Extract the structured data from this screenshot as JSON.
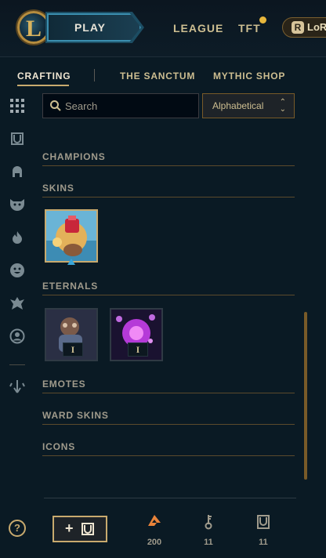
{
  "header": {
    "play_label": "PLAY",
    "nav": [
      "LEAGUE",
      "TFT"
    ],
    "lor_label": "LoR",
    "lor_icon": "R"
  },
  "tabs": [
    {
      "label": "CRAFTING",
      "active": true
    },
    {
      "label": "THE SANCTUM",
      "active": false
    },
    {
      "label": "MYTHIC SHOP",
      "active": false
    }
  ],
  "rail_icons": [
    "grid-icon",
    "chest-icon",
    "champion-helmet-icon",
    "skin-mask-icon",
    "flame-icon",
    "emote-icon",
    "ward-icon",
    "profile-icon",
    "arrow-down-icon"
  ],
  "search": {
    "placeholder": "Search",
    "value": ""
  },
  "sort": {
    "selected": "Alphabetical"
  },
  "sections": {
    "champions": "CHAMPIONS",
    "skins": "SKINS",
    "eternals": "ETERNALS",
    "emotes": "EMOTES",
    "ward_skins": "WARD SKINS",
    "icons": "ICONS"
  },
  "eternals": [
    {
      "badge": "I"
    },
    {
      "badge": "I"
    }
  ],
  "footer": {
    "help": "?",
    "add_plus": "+",
    "currencies": [
      {
        "icon": "orange-essence-icon",
        "value": "200",
        "color": "#e8833a"
      },
      {
        "icon": "key-fragment-icon",
        "value": "11",
        "color": "#a09b8c"
      },
      {
        "icon": "chest-icon",
        "value": "11",
        "color": "#a09b8c"
      }
    ]
  },
  "colors": {
    "gold": "#c8aa6e",
    "background": "#0a1a24",
    "accent_blue": "#3b8fb0"
  }
}
